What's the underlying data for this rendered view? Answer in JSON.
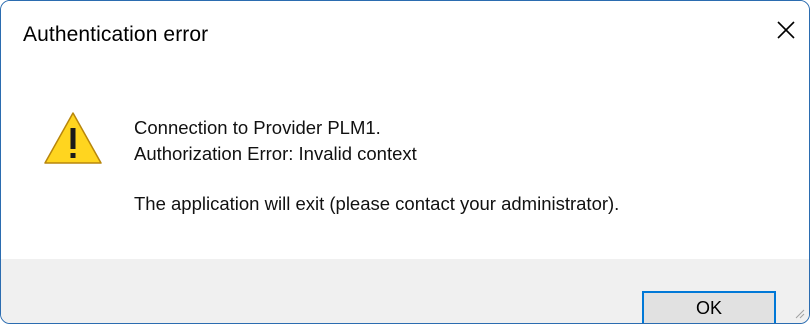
{
  "dialog": {
    "title": "Authentication error",
    "close_icon": "close-icon",
    "warning_icon": "warning-icon",
    "message": {
      "line1": "Connection to Provider PLM1.",
      "line2": "Authorization Error: Invalid context",
      "line3": "The application will exit (please contact your administrator)."
    },
    "ok_label": "OK"
  },
  "colors": {
    "border": "#2b6cb0",
    "footer_bg": "#f0f0f0",
    "button_border": "#0078d7",
    "button_bg": "#e1e1e1",
    "warning_fill": "#ffd51f"
  }
}
